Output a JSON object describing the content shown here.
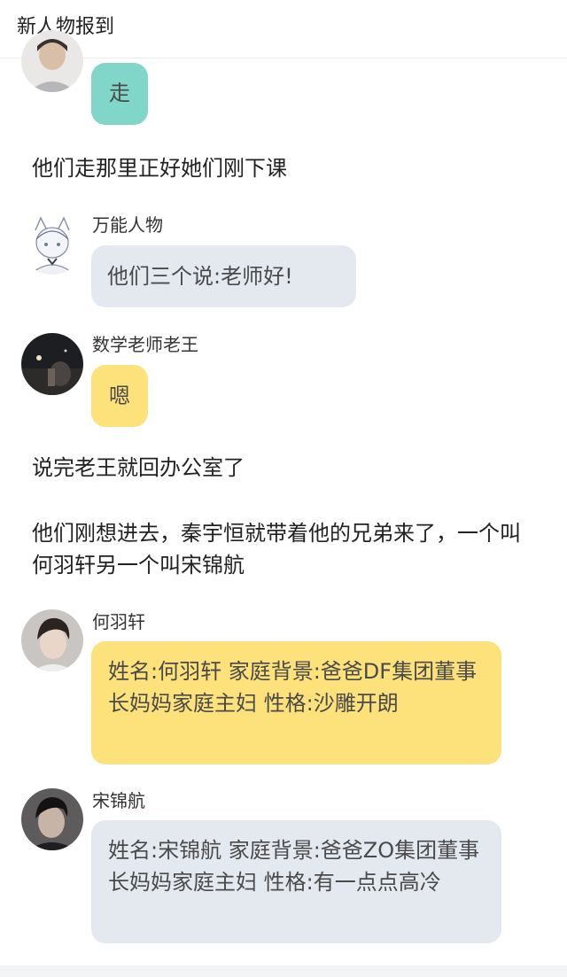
{
  "header": {
    "title": "新人物报到"
  },
  "colors": {
    "teal_bubble": "#7fd6c9",
    "gray_bubble": "#e4e8ef",
    "yellow_bubble": "#fde17a"
  },
  "messages": [
    {
      "type": "bubble",
      "sender": "",
      "color": "teal",
      "text": "走"
    },
    {
      "type": "narration",
      "text": "他们走那里正好她们刚下课"
    },
    {
      "type": "bubble",
      "sender": "万能人物",
      "color": "gray",
      "text": "他们三个说:老师好!"
    },
    {
      "type": "bubble",
      "sender": "数学老师老王",
      "color": "yellow",
      "text": "嗯"
    },
    {
      "type": "narration",
      "text": "说完老王就回办公室了"
    },
    {
      "type": "narration",
      "text": "他们刚想进去，秦宇恒就带着他的兄弟来了，一个叫何羽轩另一个叫宋锦航"
    },
    {
      "type": "bubble",
      "sender": "何羽轩",
      "color": "yellow",
      "text": "姓名:何羽轩 家庭背景:爸爸DF集团董事长妈妈家庭主妇 性格:沙雕开朗"
    },
    {
      "type": "bubble",
      "sender": "宋锦航",
      "color": "gray",
      "text": "姓名:宋锦航 家庭背景:爸爸ZO集团董事长妈妈家庭主妇 性格:有一点点高冷"
    }
  ]
}
